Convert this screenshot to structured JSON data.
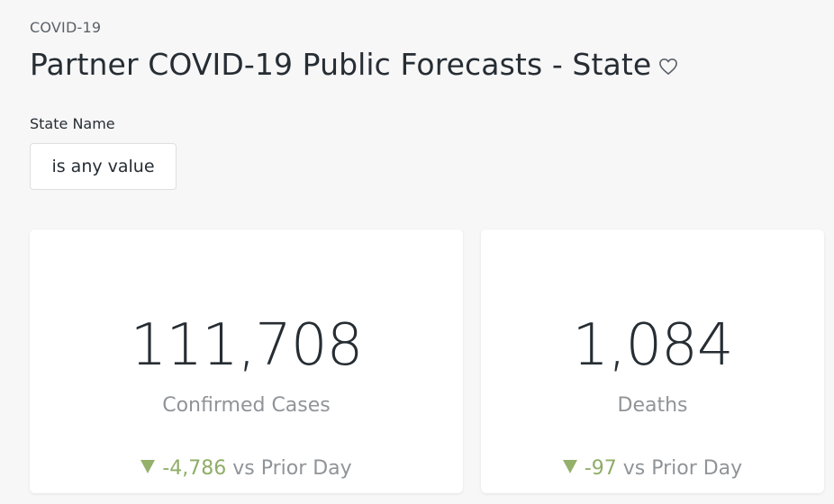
{
  "header": {
    "breadcrumb": "COVID-19",
    "title": "Partner COVID-19 Public Forecasts - State",
    "favorite_icon": "heart-outline-icon"
  },
  "filters": {
    "state_name": {
      "label": "State Name",
      "value": "is any value"
    }
  },
  "tiles": [
    {
      "value": "111,708",
      "label": "Confirmed Cases",
      "delta": "-4,786",
      "delta_suffix": " vs Prior Day",
      "trend_icon": "down-triangle-icon"
    },
    {
      "value": "1,084",
      "label": "Deaths",
      "delta": "-97",
      "delta_suffix": " vs Prior Day",
      "trend_icon": "down-triangle-icon"
    }
  ],
  "colors": {
    "delta_positive_trend": "#8fad67",
    "muted_text": "#909498",
    "primary_text": "#262d33",
    "background": "#f7f7f8"
  }
}
